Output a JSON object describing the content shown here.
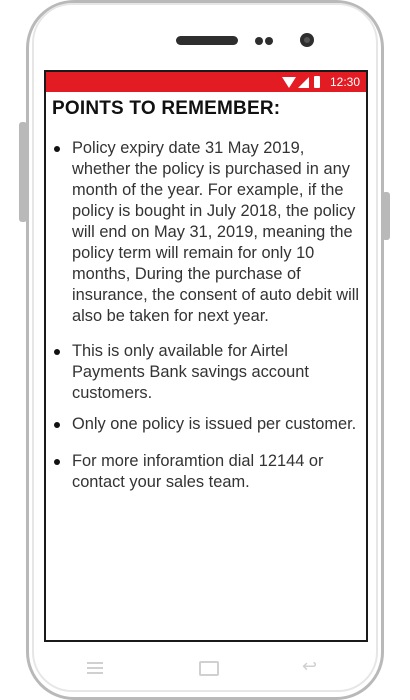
{
  "status_bar": {
    "time": "12:30",
    "background_color": "#e31b23",
    "icons": [
      "wifi-icon",
      "signal-icon",
      "battery-icon"
    ]
  },
  "content": {
    "title": "POINTS TO REMEMBER:",
    "points": [
      "Policy expiry date 31 May 2019, whether the policy is purchased in any month of the year. For example, if the policy is bought in July 2018, the policy will end on May 31, 2019, meaning the policy term will remain for only 10 months, During the purchase of insurance, the consent of auto debit will also be taken for next year.",
      "This is only available for Airtel Payments Bank savings account customers.",
      "Only one policy is issued per customer.",
      "For more inforamtion dial 12144 or contact your sales team."
    ]
  },
  "nav_bar": {
    "icons": [
      "menu-icon",
      "home-icon",
      "back-icon"
    ]
  }
}
